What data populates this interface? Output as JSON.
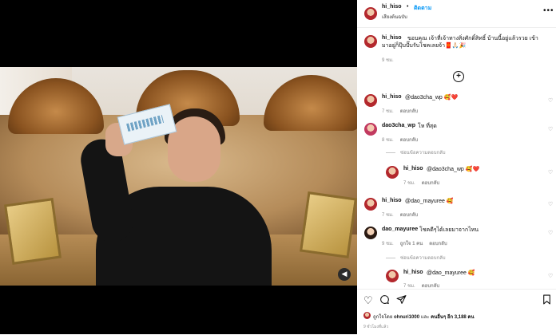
{
  "header": {
    "username": "hi_hiso",
    "follow_label": "ติดตาม",
    "subtitle": "เสียงต้นฉบับ",
    "more_icon": "more-horizontal-icon"
  },
  "caption": {
    "username": "hi_hiso",
    "text": "ขอบคุณ เจ้าที่เจ้าทางสิ่งศักดิ์สิทธิ์ บ้านนี้อยู่แล้วรวย เข้ามาอยู่ก็ปุ๊บปั๊บรับโชคเลยจ้า🧧🙏🏻🎉",
    "time": "9 ชม."
  },
  "load_more_icon": "plus-circle-icon",
  "comments": [
    {
      "username": "hi_hiso",
      "text": "@dao3cha_wp 🥰❤️",
      "time": "7 ชม.",
      "reply_label": "ตอบกลับ"
    },
    {
      "username": "dao3cha_wp",
      "text": "โห ที่สุด",
      "time": "8 ชม.",
      "reply_label": "ตอบกลับ",
      "toggle_label": "ซ่อนข้อความตอบกลับ",
      "reply": {
        "username": "hi_hiso",
        "text": "@dao3cha_wp 🥰❤️",
        "time": "7 ชม.",
        "reply_label": "ตอบกลับ"
      }
    },
    {
      "username": "hi_hiso",
      "text": "@dao_mayuree 🥰",
      "time": "7 ชม.",
      "reply_label": "ตอบกลับ"
    },
    {
      "username": "dao_mayuree",
      "text": "โชคดีๆได้เลยมาจากไหน",
      "time": "9 ชม.",
      "likes": "ถูกใจ 1 คน",
      "reply_label": "ตอบกลับ",
      "toggle_label": "ซ่อนข้อความตอบกลับ",
      "reply": {
        "username": "hi_hiso",
        "text": "@dao_mayuree 🥰",
        "time": "7 ชม.",
        "reply_label": "ตอบกลับ"
      }
    }
  ],
  "actions": {
    "like_icon": "heart-icon",
    "comment_icon": "comment-icon",
    "share_icon": "send-icon",
    "save_icon": "bookmark-icon",
    "likes_text_prefix": "ถูกใจโดย ",
    "likes_user": "ohnuri1000",
    "likes_text_mid": " และ ",
    "likes_others": "คนอื่นๆ อีก 3,188 คน",
    "post_time": "9 ชั่วโมงที่แล้ว"
  },
  "video": {
    "volume_icon": "volume-icon"
  }
}
